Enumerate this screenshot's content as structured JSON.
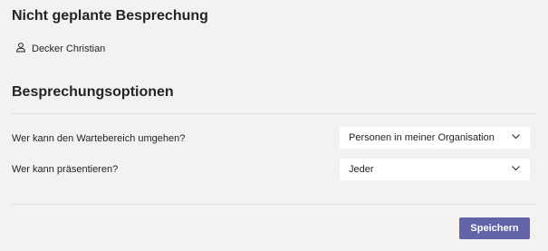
{
  "meeting": {
    "title": "Nicht geplante Besprechung",
    "organizer_name": "Decker Christian",
    "organizer_icon": "person-icon"
  },
  "options_section": {
    "title": "Besprechungsoptionen",
    "options": [
      {
        "label": "Wer kann den Wartebereich umgehen?",
        "selected_value": "Personen in meiner Organisation",
        "icon": "chevron-down-icon"
      },
      {
        "label": "Wer kann präsentieren?",
        "selected_value": "Jeder",
        "icon": "chevron-down-icon"
      }
    ]
  },
  "footer": {
    "save_label": "Speichern"
  },
  "colors": {
    "background": "#f3f2f1",
    "accent": "#6264a7",
    "field_background": "#ffffff",
    "divider": "#e1dfdd",
    "text": "#252423"
  }
}
